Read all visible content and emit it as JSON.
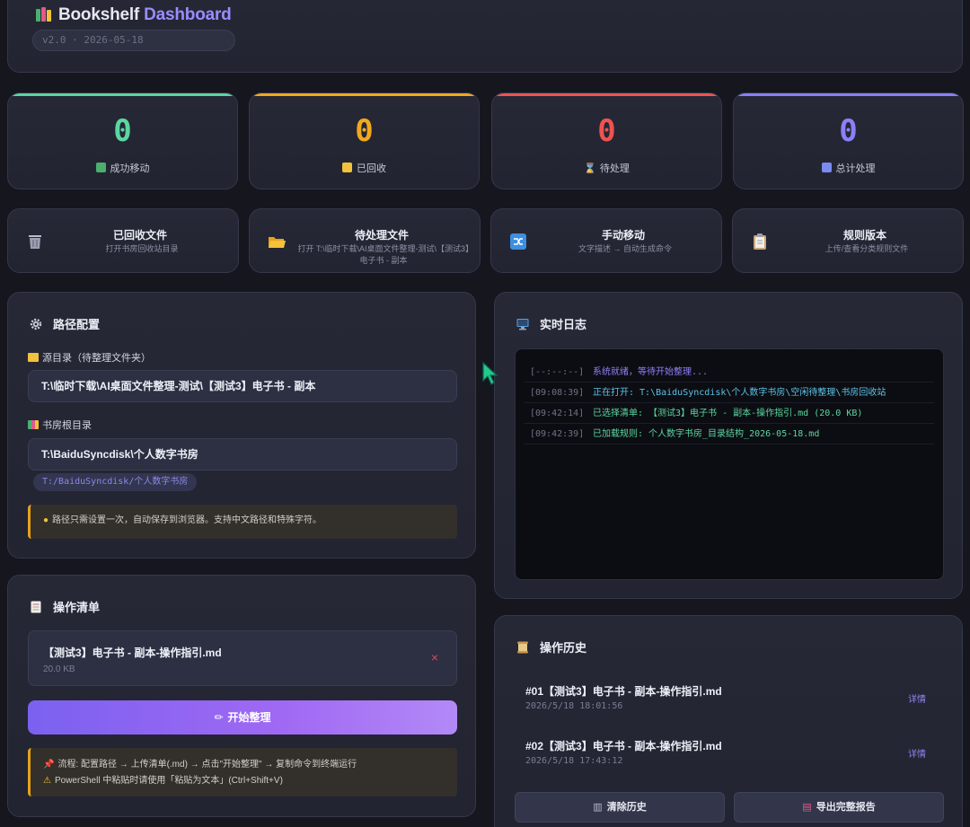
{
  "header": {
    "title_main": "Bookshelf ",
    "title_accent": "Dashboard",
    "version": "v2.0 · 2026-05-18"
  },
  "stats": [
    {
      "value": "0",
      "label": "成功移动",
      "color": "#5ad6a0",
      "icon": "chart-up-icon"
    },
    {
      "value": "0",
      "label": "已回收",
      "color": "#f2a81c",
      "icon": "folder-icon"
    },
    {
      "value": "0",
      "label": "待处理",
      "color": "#ef5350",
      "icon": "hourglass-icon"
    },
    {
      "value": "0",
      "label": "总计处理",
      "color": "#8b80f9",
      "icon": "bar-chart-icon"
    }
  ],
  "actions": [
    {
      "title": "已回收文件",
      "sub": "打开书房回收站目录",
      "icon": "trash-icon"
    },
    {
      "title": "待处理文件",
      "sub": "打开 T:\\临时下载\\AI桌面文件整理-测试\\【测试3】电子书 - 副本",
      "icon": "folder-open-icon"
    },
    {
      "title": "手动移动",
      "sub": "文字描述 → 自动生成命令",
      "icon": "shuffle-icon"
    },
    {
      "title": "规则版本",
      "sub": "上传/查看分类规则文件",
      "icon": "clipboard-icon"
    }
  ],
  "path_config": {
    "title": "路径配置",
    "source_label": "源目录（待整理文件夹）",
    "source_value": "T:\\临时下载\\AI桌面文件整理-测试\\【测试3】电子书 - 副本",
    "root_label": "书房根目录",
    "root_value": "T:\\BaiduSyncdisk\\个人数字书房",
    "root_chip": "T:/BaiduSyncdisk/个人数字书房",
    "tip": "路径只需设置一次，自动保存到浏览器。支持中文路径和特殊字符。"
  },
  "log": {
    "title": "实时日志",
    "lines": [
      {
        "time": "[--:--:--]",
        "msg": "系统就绪，等待开始整理...",
        "color": "#8b80f9"
      },
      {
        "time": "[09:08:39]",
        "msg": "正在打开: T:\\BaiduSyncdisk\\个人数字书房\\空闲待整理\\书房回收站",
        "color": "#5cc3e8"
      },
      {
        "time": "[09:42:14]",
        "msg": "已选择清单: 【测试3】电子书 - 副本-操作指引.md (20.0 KB)",
        "color": "#5ad6a0"
      },
      {
        "time": "[09:42:39]",
        "msg": "已加载规则: 个人数字书房_目录结构_2026-05-18.md",
        "color": "#5ad6a0"
      }
    ]
  },
  "tasks": {
    "title": "操作清单",
    "item_name": "【测试3】电子书 - 副本-操作指引.md",
    "item_size": "20.0 KB",
    "remove": "×",
    "start_label": "开始整理",
    "flow_line1": "流程: 配置路径 → 上传清单(.md) → 点击\"开始整理\" → 复制命令到终端运行",
    "flow_line2": "PowerShell 中粘贴时请使用「粘贴为文本」(Ctrl+Shift+V)"
  },
  "history": {
    "title": "操作历史",
    "items": [
      {
        "title": "#01【测试3】电子书 - 副本-操作指引.md",
        "date": "2026/5/18 18:01:56",
        "detail": "详情"
      },
      {
        "title": "#02【测试3】电子书 - 副本-操作指引.md",
        "date": "2026/5/18 17:43:12",
        "detail": "详情"
      }
    ],
    "clear_label": "清除历史",
    "export_label": "导出完整报告"
  }
}
